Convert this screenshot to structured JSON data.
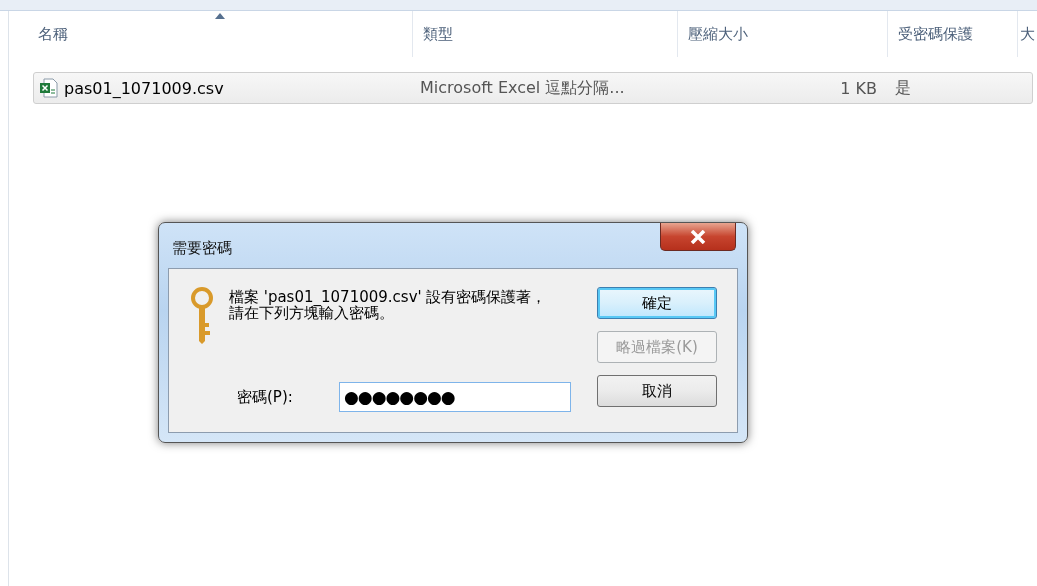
{
  "file_list": {
    "columns": [
      {
        "label": "名稱",
        "sorted": true
      },
      {
        "label": "類型",
        "sorted": false
      },
      {
        "label": "壓縮大小",
        "sorted": false
      },
      {
        "label": "受密碼保護",
        "sorted": false
      },
      {
        "label": "大",
        "sorted": false
      }
    ],
    "rows": [
      {
        "name": "pas01_1071009.csv",
        "type": "Microsoft Excel 逗點分隔...",
        "size": "1 KB",
        "protected": "是",
        "selected": true
      }
    ]
  },
  "dialog": {
    "title": "需要密碼",
    "message": "檔案 'pas01_1071009.csv' 設有密碼保護著，請在下列方塊輸入密碼。",
    "password_label": "密碼(P):",
    "password_value": "●●●●●●●●",
    "buttons": [
      {
        "label": "確定",
        "kind": "default",
        "disabled": false
      },
      {
        "label": "略過檔案(K)",
        "kind": "normal",
        "disabled": true
      },
      {
        "label": "取消",
        "kind": "normal",
        "disabled": false
      }
    ]
  }
}
